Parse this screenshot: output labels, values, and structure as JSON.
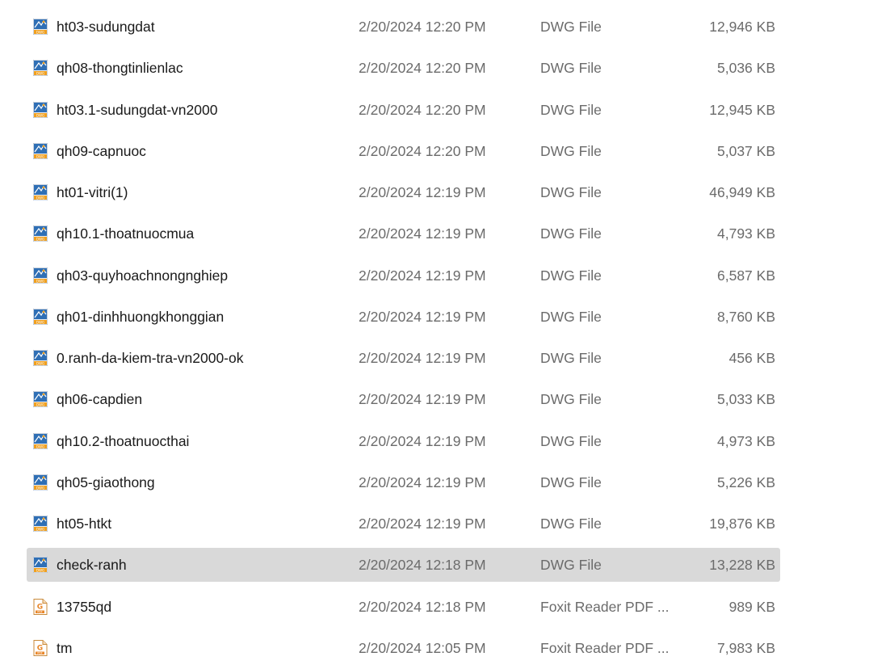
{
  "files": [
    {
      "name": "ht03-sudungdat",
      "date": "2/20/2024 12:20 PM",
      "type": "DWG File",
      "size": "12,946 KB",
      "icon": "dwg-file-icon",
      "selected": false
    },
    {
      "name": "qh08-thongtinlienlac",
      "date": "2/20/2024 12:20 PM",
      "type": "DWG File",
      "size": "5,036 KB",
      "icon": "dwg-file-icon",
      "selected": false
    },
    {
      "name": "ht03.1-sudungdat-vn2000",
      "date": "2/20/2024 12:20 PM",
      "type": "DWG File",
      "size": "12,945 KB",
      "icon": "dwg-file-icon",
      "selected": false
    },
    {
      "name": "qh09-capnuoc",
      "date": "2/20/2024 12:20 PM",
      "type": "DWG File",
      "size": "5,037 KB",
      "icon": "dwg-file-icon",
      "selected": false
    },
    {
      "name": "ht01-vitri(1)",
      "date": "2/20/2024 12:19 PM",
      "type": "DWG File",
      "size": "46,949 KB",
      "icon": "dwg-file-icon",
      "selected": false
    },
    {
      "name": "qh10.1-thoatnuocmua",
      "date": "2/20/2024 12:19 PM",
      "type": "DWG File",
      "size": "4,793 KB",
      "icon": "dwg-file-icon",
      "selected": false
    },
    {
      "name": "qh03-quyhoachnongnghiep",
      "date": "2/20/2024 12:19 PM",
      "type": "DWG File",
      "size": "6,587 KB",
      "icon": "dwg-file-icon",
      "selected": false
    },
    {
      "name": "qh01-dinhhuongkhonggian",
      "date": "2/20/2024 12:19 PM",
      "type": "DWG File",
      "size": "8,760 KB",
      "icon": "dwg-file-icon",
      "selected": false
    },
    {
      "name": "0.ranh-da-kiem-tra-vn2000-ok",
      "date": "2/20/2024 12:19 PM",
      "type": "DWG File",
      "size": "456 KB",
      "icon": "dwg-file-icon",
      "selected": false
    },
    {
      "name": "qh06-capdien",
      "date": "2/20/2024 12:19 PM",
      "type": "DWG File",
      "size": "5,033 KB",
      "icon": "dwg-file-icon",
      "selected": false
    },
    {
      "name": "qh10.2-thoatnuocthai",
      "date": "2/20/2024 12:19 PM",
      "type": "DWG File",
      "size": "4,973 KB",
      "icon": "dwg-file-icon",
      "selected": false
    },
    {
      "name": "qh05-giaothong",
      "date": "2/20/2024 12:19 PM",
      "type": "DWG File",
      "size": "5,226 KB",
      "icon": "dwg-file-icon",
      "selected": false
    },
    {
      "name": "ht05-htkt",
      "date": "2/20/2024 12:19 PM",
      "type": "DWG File",
      "size": "19,876 KB",
      "icon": "dwg-file-icon",
      "selected": false
    },
    {
      "name": "check-ranh",
      "date": "2/20/2024 12:18 PM",
      "type": "DWG File",
      "size": "13,228 KB",
      "icon": "dwg-file-icon",
      "selected": true
    },
    {
      "name": "13755qd",
      "date": "2/20/2024 12:18 PM",
      "type": "Foxit Reader PDF ...",
      "size": "989 KB",
      "icon": "pdf-file-icon",
      "selected": false
    },
    {
      "name": "tm",
      "date": "2/20/2024 12:05 PM",
      "type": "Foxit Reader PDF ...",
      "size": "7,983 KB",
      "icon": "pdf-file-icon",
      "selected": false
    }
  ],
  "colors": {
    "selected_row": "#d9d9d9",
    "dwg_icon_blue": "#2f6fb5",
    "dwg_icon_accent": "#f0a020",
    "pdf_icon_orange": "#e8872a"
  }
}
